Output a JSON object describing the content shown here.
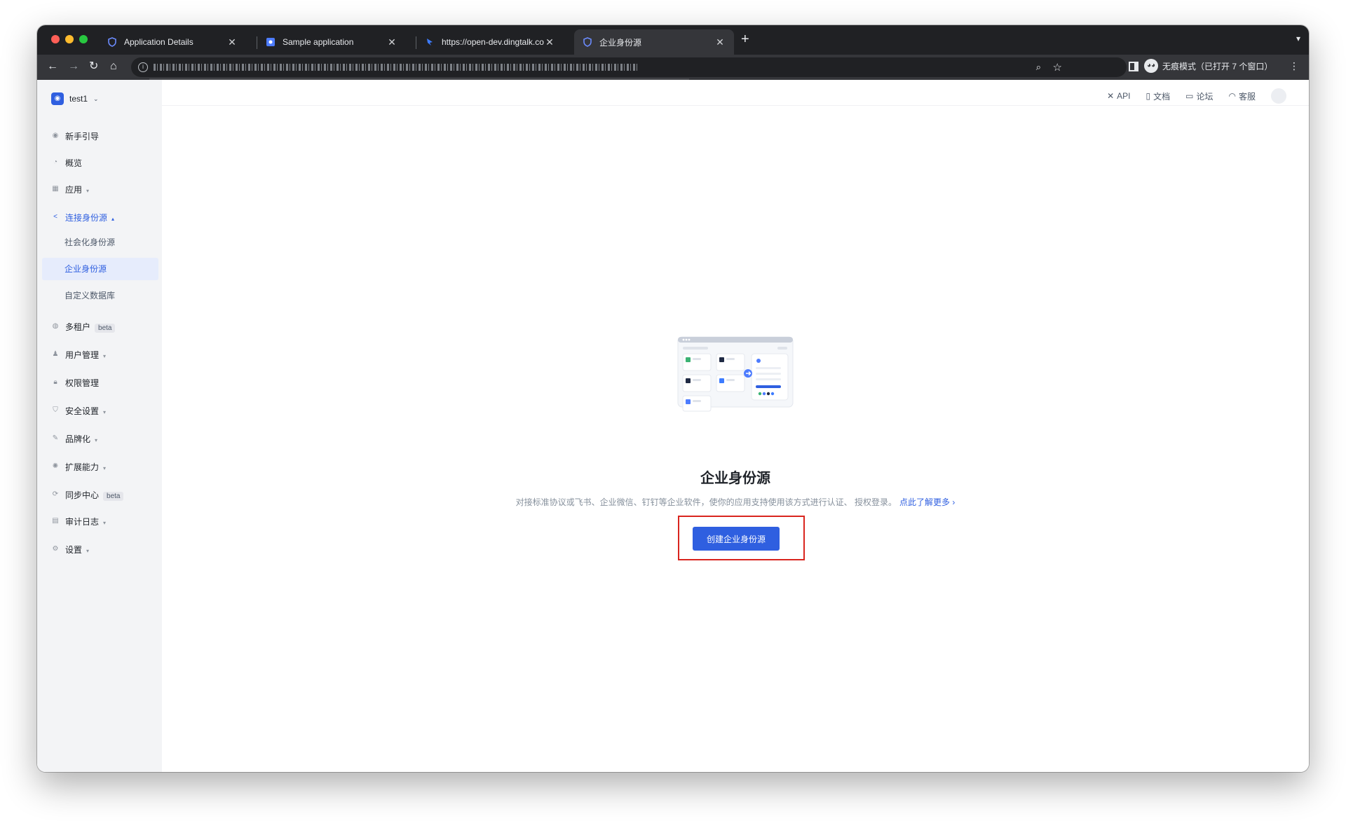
{
  "browser": {
    "tabs": [
      {
        "title": "Application Details"
      },
      {
        "title": "Sample application"
      },
      {
        "title": "https://open-dev.dingtalk.com/"
      },
      {
        "title": "企业身份源"
      }
    ],
    "incognito_label": "无痕模式（已打开 7 个窗口）"
  },
  "sidebar": {
    "app_name": "test1",
    "items": {
      "guide": "新手引导",
      "overview": "概览",
      "apps": "应用",
      "idp": "连接身份源",
      "multi_tenant": "多租户",
      "users": "用户管理",
      "permissions": "权限管理",
      "security": "安全设置",
      "branding": "品牌化",
      "extensions": "扩展能力",
      "sync": "同步中心",
      "audit": "审计日志",
      "settings": "设置"
    },
    "sub_items": {
      "social": "社会化身份源",
      "enterprise": "企业身份源",
      "custom_db": "自定义数据库"
    },
    "beta": "beta"
  },
  "topnav": {
    "api": "API",
    "docs": "文档",
    "forum": "论坛",
    "support": "客服"
  },
  "empty_state": {
    "title": "企业身份源",
    "description": "对接标准协议或飞书、企业微信、钉钉等企业软件，使你的应用支持使用该方式进行认证、 授权登录。",
    "learn_more": "点此了解更多 ›",
    "create_button": "创建企业身份源"
  },
  "colors": {
    "primary": "#2f5fe0",
    "highlight": "#d9251e",
    "sidebar_bg": "#f3f4f6"
  }
}
